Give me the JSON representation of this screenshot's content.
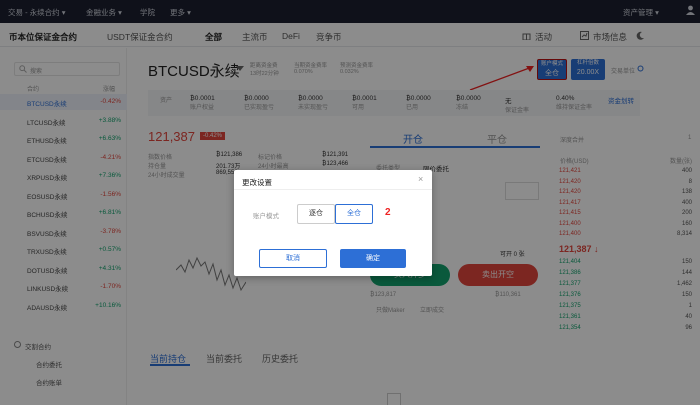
{
  "topnav": {
    "left": [
      "交易 - 永续合约 ▾",
      "金融业务 ▾",
      "学院",
      "更多 ▾"
    ],
    "right": "资产管理 ▾"
  },
  "subnav": {
    "tabs": [
      "币本位保证金合约",
      "USDT保证金合约"
    ],
    "filters": [
      "全部",
      "主流币",
      "DeFi",
      "竞争币"
    ],
    "activity": "活动",
    "market_info": "市场信息"
  },
  "sidebar": {
    "search_placeholder": "搜索",
    "col_symbol": "合约",
    "col_change": "涨幅",
    "items": [
      {
        "symbol": "BTCUSD永续",
        "change": "-0.42%",
        "dir": "down",
        "active": true
      },
      {
        "symbol": "LTCUSD永续",
        "change": "+3.88%",
        "dir": "up"
      },
      {
        "symbol": "ETHUSD永续",
        "change": "+6.63%",
        "dir": "up"
      },
      {
        "symbol": "ETCUSD永续",
        "change": "-4.21%",
        "dir": "down"
      },
      {
        "symbol": "XRPUSD永续",
        "change": "+7.36%",
        "dir": "up"
      },
      {
        "symbol": "EOSUSD永续",
        "change": "-1.56%",
        "dir": "down"
      },
      {
        "symbol": "BCHUSD永续",
        "change": "+6.81%",
        "dir": "up"
      },
      {
        "symbol": "BSVUSD永续",
        "change": "-3.78%",
        "dir": "down"
      },
      {
        "symbol": "TRXUSD永续",
        "change": "+0.57%",
        "dir": "up"
      },
      {
        "symbol": "DOTUSD永续",
        "change": "+4.31%",
        "dir": "up"
      },
      {
        "symbol": "LINKUSD永续",
        "change": "-1.70%",
        "dir": "down"
      },
      {
        "symbol": "ADAUSD永续",
        "change": "+10.16%",
        "dir": "up"
      }
    ],
    "section_title": "交割合约",
    "links": [
      "合约委托",
      "合约账单"
    ]
  },
  "header": {
    "contract": "BTCUSD永续",
    "funding_label": "距离资金费",
    "funding_time": "13时22分钟",
    "rate_label": "当期资金费率",
    "rate": "0.070%",
    "next_rate_label": "预测资金费率",
    "next_rate": "0.032%",
    "mode_btn_label": "账户模式",
    "mode_btn_value": "全仓",
    "lev_btn_label": "杠杆倍数",
    "lev_btn_value": "20.00X",
    "guide": "交易单位"
  },
  "stats": [
    {
      "label": "资产",
      "value": ""
    },
    {
      "label": "账户权益",
      "value": "₿0.0001"
    },
    {
      "label": "已实现盈亏",
      "value": "₿0.0000"
    },
    {
      "label": "未实现盈亏",
      "value": "₿0.0000"
    },
    {
      "label": "可用",
      "value": "₿0.0001"
    },
    {
      "label": "已用",
      "value": "₿0.0000"
    },
    {
      "label": "冻结",
      "value": "₿0.0000"
    },
    {
      "label": "保证金率",
      "value": "无"
    },
    {
      "label": "维持保证金率",
      "value": "0.40%"
    },
    {
      "label": "",
      "value": "资金划转"
    }
  ],
  "price": {
    "last": "121,387",
    "badge": "-0.42%",
    "mark_label": "指数价格",
    "mark": "₿121,386",
    "index_label": "标记价格",
    "index": "₿121,391",
    "vol_label": "持仓量",
    "vol": "201.73万",
    "high_label": "24小时最高",
    "high": "₿123,466",
    "turnover_label": "24小时成交量",
    "turnover": "869,552"
  },
  "trade": {
    "open_tab": "开仓",
    "close_tab": "平仓",
    "order_type_label": "委托类型",
    "order_type": "限价委托",
    "available": "可开 0 张",
    "buy": "买入开多",
    "sell": "卖出开空",
    "buy_price": "₿123,817",
    "sell_price": "₿110,361",
    "opt1": "只做Maker",
    "opt2": "立即成交"
  },
  "bottom_tabs": [
    "当前持仓",
    "当前委托",
    "历史委托"
  ],
  "book": {
    "header_left": "深度合并",
    "header_right": "1",
    "col_price": "价格(USD)",
    "col_qty": "数量(张)",
    "asks": [
      [
        "121,421",
        "400"
      ],
      [
        "121,420",
        "8"
      ],
      [
        "121,420",
        "138"
      ],
      [
        "121,417",
        "400"
      ],
      [
        "121,415",
        "200"
      ],
      [
        "121,400",
        "160"
      ],
      [
        "121,400",
        "8,314"
      ]
    ],
    "last": "121,387 ↓",
    "bids": [
      [
        "121,404",
        "150"
      ],
      [
        "121,386",
        "144"
      ],
      [
        "121,377",
        "1,462"
      ],
      [
        "121,376",
        "150"
      ],
      [
        "121,375",
        "1"
      ],
      [
        "121,361",
        "40"
      ],
      [
        "121,354",
        "96"
      ]
    ]
  },
  "modal": {
    "title": "更改设置",
    "close": "×",
    "label": "账户模式",
    "opt_isolated": "逐仓",
    "opt_cross": "全仓",
    "step_num": "2",
    "cancel": "取消",
    "confirm": "确定"
  }
}
